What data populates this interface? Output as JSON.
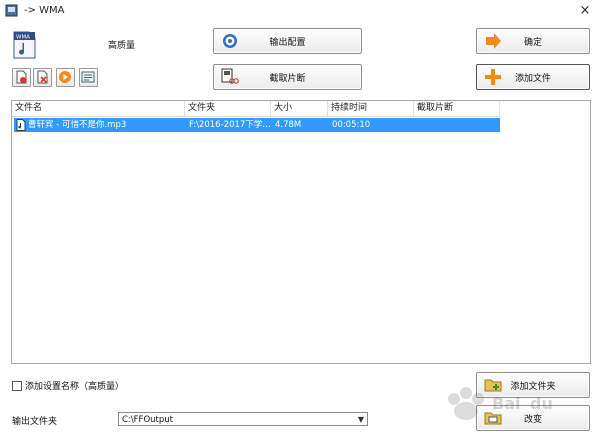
{
  "window": {
    "title": "-> WMA",
    "close": "×"
  },
  "preset": {
    "quality_label": "高质量"
  },
  "buttons": {
    "output_config": "输出配置",
    "clip": "截取片断",
    "confirm": "确定",
    "add_file": "添加文件",
    "add_folder": "添加文件夹",
    "change": "改变"
  },
  "list": {
    "columns": [
      "文件名",
      "文件夹",
      "大小",
      "持续时间",
      "截取片断"
    ],
    "rows": [
      {
        "name": "曹轩宾 - 可惜不是你.mp3",
        "folder": "F:\\2016-2017下学…",
        "size": "4.78M",
        "duration": "00:05:10",
        "clip": ""
      }
    ]
  },
  "options": {
    "add_setting_name": "添加设置名称（高质量）"
  },
  "output": {
    "label": "输出文件夹",
    "path": "C:\\FFOutput"
  },
  "colors": {
    "selection": "#3399ff",
    "accent_orange": "#f28a1e"
  },
  "icons": {
    "app": "app-icon",
    "wma_file": "wma-file-icon",
    "remove": "remove-file-icon",
    "clear": "clear-list-icon",
    "play": "play-icon",
    "info": "media-info-icon",
    "config": "gear-icon",
    "clip": "clip-icon",
    "confirm": "arrow-right-icon",
    "add": "plus-icon",
    "folder": "folder-add-icon",
    "change": "folder-change-icon",
    "audio": "audio-file-icon"
  }
}
